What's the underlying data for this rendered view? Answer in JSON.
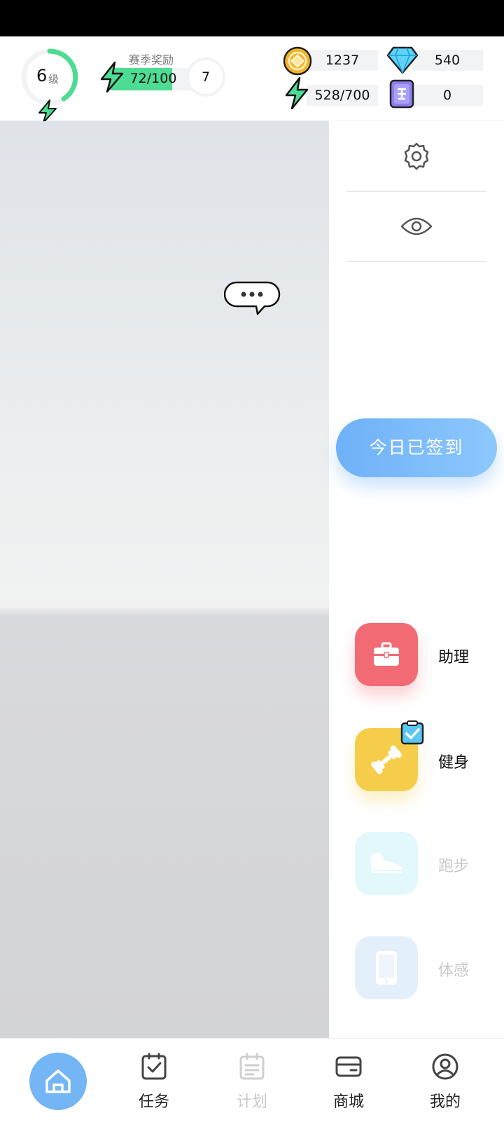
{
  "header": {
    "level": {
      "number": "6",
      "unit": "级",
      "progress": 0.42
    },
    "season": {
      "label": "赛季奖励",
      "progress_text": "72/100",
      "progress": 0.72,
      "badge": "7"
    },
    "resources": {
      "coins": "1237",
      "diamonds": "540",
      "energy": "528/700",
      "tickets": "0"
    }
  },
  "sidebar": {
    "settings_icon": "gear-icon",
    "visibility_icon": "eye-icon",
    "checkin_label": "今日已签到",
    "features": [
      {
        "label": "助理",
        "icon": "briefcase-icon",
        "color": "#f26b74",
        "enabled": true
      },
      {
        "label": "健身",
        "icon": "dumbbell-icon",
        "color": "#f5cd4b",
        "enabled": true
      },
      {
        "label": "跑步",
        "icon": "shoe-icon",
        "color": "#e2f8fa",
        "enabled": false
      },
      {
        "label": "体感",
        "icon": "phone-icon",
        "color": "#e4effc",
        "enabled": false
      }
    ]
  },
  "nav": {
    "home_icon": "home-icon",
    "tasks": "任务",
    "plan": "计划",
    "shop": "商城",
    "mine": "我的"
  },
  "colors": {
    "accent_blue": "#74b5f6",
    "green": "#4ddc93",
    "assistant_red": "#f26b74",
    "fitness_yellow": "#f5cd4b"
  }
}
